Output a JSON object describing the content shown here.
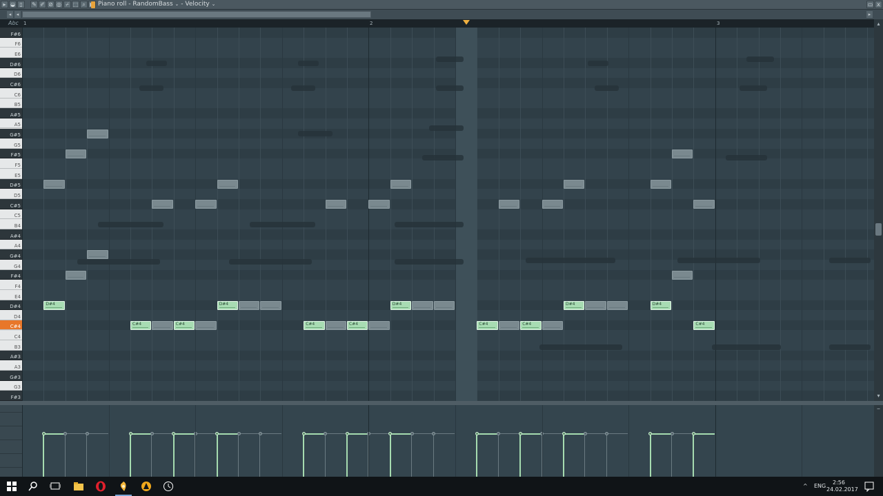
{
  "window": {
    "title_parts": [
      "Piano roll",
      "RandomBass",
      "Velocity"
    ],
    "title_sep": "-",
    "close_icon": "x",
    "scroll_left_arrow": "◂"
  },
  "timeline": {
    "label": "Abc",
    "bar_numbers": [
      "1",
      "2",
      "3"
    ]
  },
  "keys": [
    {
      "name": "F#6",
      "black": true
    },
    {
      "name": "F6",
      "black": false
    },
    {
      "name": "E6",
      "black": false
    },
    {
      "name": "D#6",
      "black": true
    },
    {
      "name": "D6",
      "black": false
    },
    {
      "name": "C#6",
      "black": true
    },
    {
      "name": "C6",
      "black": false
    },
    {
      "name": "B5",
      "black": false
    },
    {
      "name": "A#5",
      "black": true
    },
    {
      "name": "A5",
      "black": false
    },
    {
      "name": "G#5",
      "black": true
    },
    {
      "name": "G5",
      "black": false
    },
    {
      "name": "F#5",
      "black": true
    },
    {
      "name": "F5",
      "black": false
    },
    {
      "name": "E5",
      "black": false
    },
    {
      "name": "D#5",
      "black": true
    },
    {
      "name": "D5",
      "black": false
    },
    {
      "name": "C#5",
      "black": true
    },
    {
      "name": "C5",
      "black": false
    },
    {
      "name": "B4",
      "black": false
    },
    {
      "name": "A#4",
      "black": true
    },
    {
      "name": "A4",
      "black": false
    },
    {
      "name": "G#4",
      "black": true
    },
    {
      "name": "G4",
      "black": false
    },
    {
      "name": "F#4",
      "black": true
    },
    {
      "name": "F4",
      "black": false
    },
    {
      "name": "E4",
      "black": false
    },
    {
      "name": "D#4",
      "black": true
    },
    {
      "name": "D4",
      "black": false
    },
    {
      "name": "C#4",
      "black": true,
      "highlight": true
    },
    {
      "name": "C4",
      "black": false
    },
    {
      "name": "B3",
      "black": false
    },
    {
      "name": "A#3",
      "black": true
    },
    {
      "name": "A3",
      "black": false
    },
    {
      "name": "G#3",
      "black": true
    },
    {
      "name": "G3",
      "black": false
    },
    {
      "name": "F#3",
      "black": true
    }
  ],
  "notes": [
    {
      "label": "D#4",
      "key": "D#4",
      "step": 1,
      "len": 1,
      "active": true
    },
    {
      "label": "C#4",
      "key": "C#4",
      "step": 5,
      "len": 1,
      "active": true
    },
    {
      "label": "",
      "key": "C#4",
      "step": 6,
      "len": 1,
      "active": false
    },
    {
      "label": "C#4",
      "key": "C#4",
      "step": 7,
      "len": 1,
      "active": true
    },
    {
      "label": "",
      "key": "C#4",
      "step": 8,
      "len": 1,
      "active": false
    },
    {
      "label": "D#4",
      "key": "D#4",
      "step": 9,
      "len": 1,
      "active": true
    },
    {
      "label": "",
      "key": "D#4",
      "step": 10,
      "len": 1,
      "active": false
    },
    {
      "label": "",
      "key": "D#4",
      "step": 11,
      "len": 1,
      "active": false
    },
    {
      "label": "C#4",
      "key": "C#4",
      "step": 13,
      "len": 1,
      "active": true
    },
    {
      "label": "",
      "key": "C#4",
      "step": 14,
      "len": 1,
      "active": false
    },
    {
      "label": "C#4",
      "key": "C#4",
      "step": 15,
      "len": 1,
      "active": true
    },
    {
      "label": "",
      "key": "C#4",
      "step": 16,
      "len": 1,
      "active": false
    },
    {
      "label": "D#4",
      "key": "D#4",
      "step": 17,
      "len": 1,
      "active": true
    },
    {
      "label": "",
      "key": "D#4",
      "step": 18,
      "len": 1,
      "active": false
    },
    {
      "label": "",
      "key": "D#4",
      "step": 19,
      "len": 1,
      "active": false
    },
    {
      "label": "C#4",
      "key": "C#4",
      "step": 21,
      "len": 1,
      "active": true
    },
    {
      "label": "",
      "key": "C#4",
      "step": 22,
      "len": 1,
      "active": false
    },
    {
      "label": "C#4",
      "key": "C#4",
      "step": 23,
      "len": 1,
      "active": true
    },
    {
      "label": "",
      "key": "C#4",
      "step": 24,
      "len": 1,
      "active": false
    },
    {
      "label": "D#4",
      "key": "D#4",
      "step": 25,
      "len": 1,
      "active": true
    },
    {
      "label": "",
      "key": "D#4",
      "step": 26,
      "len": 1,
      "active": false
    },
    {
      "label": "",
      "key": "D#4",
      "step": 27,
      "len": 1,
      "active": false
    },
    {
      "label": "D#4",
      "key": "D#4",
      "step": 29,
      "len": 1,
      "active": true
    },
    {
      "label": "C#4",
      "key": "C#4",
      "step": 31,
      "len": 1,
      "active": true
    },
    {
      "label": "",
      "key": "D#5",
      "step": 1,
      "len": 1,
      "active": false
    },
    {
      "label": "",
      "key": "F#5",
      "step": 2,
      "len": 1,
      "active": false
    },
    {
      "label": "",
      "key": "G#5",
      "step": 3,
      "len": 1,
      "active": false
    },
    {
      "label": "",
      "key": "F#4",
      "step": 2,
      "len": 1,
      "active": false
    },
    {
      "label": "",
      "key": "G#4",
      "step": 3,
      "len": 1,
      "active": false
    },
    {
      "label": "",
      "key": "C#5",
      "step": 6,
      "len": 1,
      "active": false
    },
    {
      "label": "",
      "key": "C#5",
      "step": 8,
      "len": 1,
      "active": false
    },
    {
      "label": "",
      "key": "D#5",
      "step": 9,
      "len": 1,
      "active": false
    },
    {
      "label": "",
      "key": "C#5",
      "step": 14,
      "len": 1,
      "active": false
    },
    {
      "label": "",
      "key": "C#5",
      "step": 16,
      "len": 1,
      "active": false
    },
    {
      "label": "",
      "key": "D#5",
      "step": 17,
      "len": 1,
      "active": false
    },
    {
      "label": "",
      "key": "C#5",
      "step": 22,
      "len": 1,
      "active": false
    },
    {
      "label": "",
      "key": "C#5",
      "step": 24,
      "len": 1,
      "active": false
    },
    {
      "label": "",
      "key": "D#5",
      "step": 25,
      "len": 1,
      "active": false
    },
    {
      "label": "",
      "key": "D#5",
      "step": 29,
      "len": 1,
      "active": false
    },
    {
      "label": "",
      "key": "F#5",
      "step": 30,
      "len": 1,
      "active": false
    },
    {
      "label": "",
      "key": "F#4",
      "step": 30,
      "len": 1,
      "active": false
    },
    {
      "label": "",
      "key": "C#5",
      "step": 31,
      "len": 1,
      "active": false
    }
  ],
  "velocities": [
    {
      "step": 1,
      "active": true
    },
    {
      "step": 2,
      "active": false
    },
    {
      "step": 3,
      "active": false
    },
    {
      "step": 5,
      "active": true
    },
    {
      "step": 6,
      "active": false
    },
    {
      "step": 7,
      "active": true
    },
    {
      "step": 8,
      "active": false
    },
    {
      "step": 9,
      "active": true
    },
    {
      "step": 10,
      "active": false
    },
    {
      "step": 11,
      "active": false
    },
    {
      "step": 13,
      "active": true
    },
    {
      "step": 14,
      "active": false
    },
    {
      "step": 15,
      "active": true
    },
    {
      "step": 16,
      "active": false
    },
    {
      "step": 17,
      "active": true
    },
    {
      "step": 18,
      "active": false
    },
    {
      "step": 19,
      "active": false
    },
    {
      "step": 21,
      "active": true
    },
    {
      "step": 22,
      "active": false
    },
    {
      "step": 23,
      "active": true
    },
    {
      "step": 24,
      "active": false
    },
    {
      "step": 25,
      "active": true
    },
    {
      "step": 26,
      "active": false
    },
    {
      "step": 27,
      "active": false
    },
    {
      "step": 29,
      "active": true
    },
    {
      "step": 30,
      "active": false
    },
    {
      "step": 31,
      "active": true
    }
  ],
  "taskbar": {
    "lang": "ENG",
    "time": "2:56",
    "date": "24.02.2017",
    "tray_arrow": "^"
  },
  "colors": {
    "active_note": "#a8dcb3",
    "highlight_key": "#e8772a",
    "playhead": "#f0b040"
  }
}
